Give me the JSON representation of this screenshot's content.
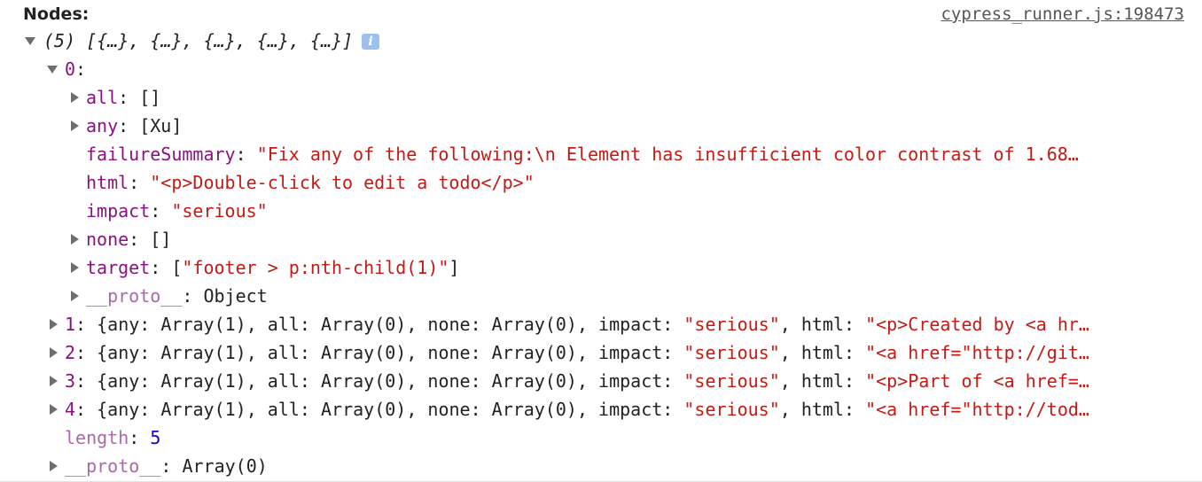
{
  "header": {
    "label": "Nodes:",
    "source_link": "cypress_runner.js:198473"
  },
  "array_summary": {
    "count": "(5)",
    "preview": "[{…}, {…}, {…}, {…}, {…}]"
  },
  "node0": {
    "index": "0",
    "fields": [
      {
        "key": "all",
        "sep": ": ",
        "value": "[]",
        "value_type": "plain"
      },
      {
        "key": "any",
        "sep": ": ",
        "value": "[Xu]",
        "value_type": "plain"
      },
      {
        "key": "failureSummary",
        "sep": ": ",
        "value": "\"Fix any of the following:\\n  Element has insufficient color contrast of 1.68…",
        "value_type": "string"
      },
      {
        "key": "html",
        "sep": ": ",
        "value": "\"<p>Double-click to edit a todo</p>\"",
        "value_type": "string"
      },
      {
        "key": "impact",
        "sep": ": ",
        "value": "\"serious\"",
        "value_type": "string"
      },
      {
        "key": "none",
        "sep": ": ",
        "value": "[]",
        "value_type": "plain"
      },
      {
        "key": "target",
        "sep": ": ",
        "value_open": "[",
        "value": "\"footer > p:nth-child(1)\"",
        "value_close": "]"
      },
      {
        "key": "__proto__",
        "sep": ": ",
        "value": "Object",
        "value_type": "plain"
      }
    ]
  },
  "collapsed_nodes": [
    {
      "index": "1",
      "pre": ": {any: Array(1), all: Array(0), none: Array(0), impact: ",
      "impact": "\"serious\"",
      "mid": ", html: ",
      "html": "\"<p>Created by <a hr…"
    },
    {
      "index": "2",
      "pre": ": {any: Array(1), all: Array(0), none: Array(0), impact: ",
      "impact": "\"serious\"",
      "mid": ", html: ",
      "html": "\"<a href=\"http://git…"
    },
    {
      "index": "3",
      "pre": ": {any: Array(1), all: Array(0), none: Array(0), impact: ",
      "impact": "\"serious\"",
      "mid": ", html: ",
      "html": "\"<p>Part of <a href=…"
    },
    {
      "index": "4",
      "pre": ": {any: Array(1), all: Array(0), none: Array(0), impact: ",
      "impact": "\"serious\"",
      "mid": ", html: ",
      "html": "\"<a href=\"http://tod…"
    }
  ],
  "length": {
    "key": "length",
    "sep": ": ",
    "value": "5"
  },
  "array_proto": {
    "key": "__proto__",
    "sep": ": ",
    "value": "Array(0)"
  }
}
